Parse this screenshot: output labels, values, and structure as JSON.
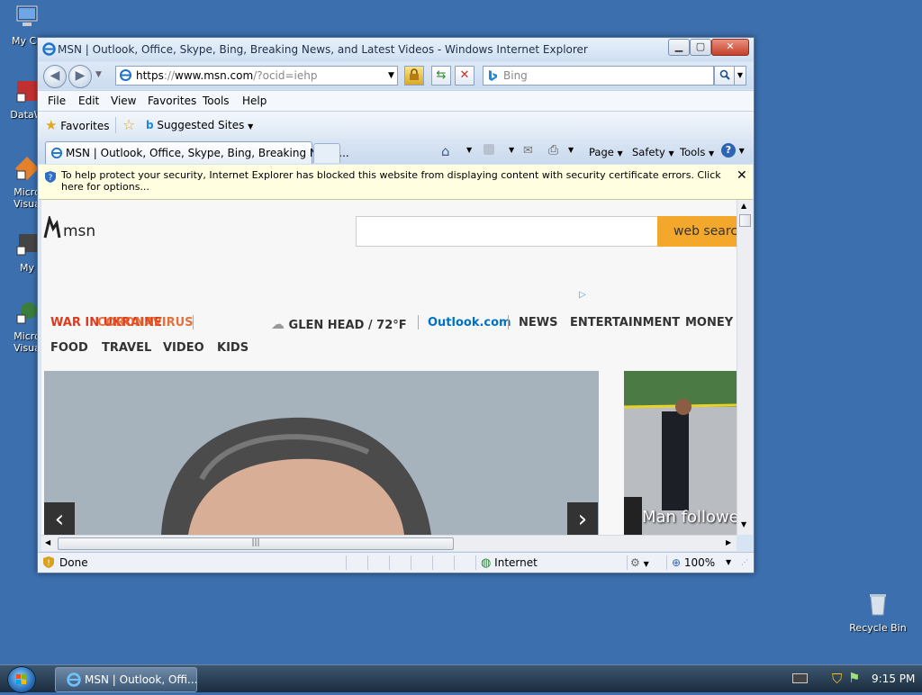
{
  "desktop": {
    "icons": [
      {
        "label": "My Co"
      },
      {
        "label": "DataW"
      },
      {
        "label": "Micro Visua"
      },
      {
        "label": "My"
      },
      {
        "label": "Micro Visua"
      }
    ],
    "recycle_bin": "Recycle Bin"
  },
  "window": {
    "title": "MSN | Outlook, Office, Skype, Bing, Breaking News, and Latest Videos - Windows Internet Explorer",
    "address": {
      "scheme": "https",
      "host": "www.msn.com",
      "path": "/?ocid=iehp"
    },
    "search_placeholder": "Bing",
    "menu": [
      "File",
      "Edit",
      "View",
      "Favorites",
      "Tools",
      "Help"
    ],
    "favorites": {
      "label": "Favorites",
      "suggested": "Suggested Sites"
    },
    "tab_title": "MSN | Outlook, Office, Skype, Bing, Breaking News...",
    "tools": {
      "page": "Page",
      "safety": "Safety",
      "tools": "Tools"
    },
    "infobar": "To help protect your security, Internet Explorer has blocked this website from displaying content with security certificate errors. Click here for options...",
    "status": {
      "text": "Done",
      "zone": "Internet",
      "zoom": "100%"
    }
  },
  "msn": {
    "logo": "msn",
    "search_button": "web search",
    "nav_row1": {
      "alert": "WAR IN UKRAINE",
      "alert_overlap": "CORONAVIRUS",
      "weather": "GLEN HEAD / 72°F",
      "outlook": "Outlook.com",
      "news": "NEWS",
      "entertainment": "ENTERTAINMENT",
      "money": "MONEY"
    },
    "nav_row2": [
      "FOOD",
      "TRAVEL",
      "VIDEO",
      "KIDS"
    ],
    "side_caption": "Man followe"
  },
  "taskbar": {
    "window_button": "MSN | Outlook, Offi...",
    "clock": "9:15 PM"
  },
  "colors": {
    "accent_orange": "#f3a82b",
    "outlook_blue": "#0072c6",
    "alert_red": "#e03a1e"
  }
}
